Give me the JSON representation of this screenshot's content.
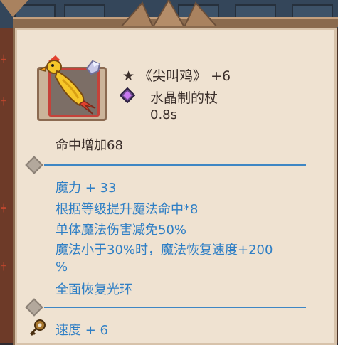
{
  "item": {
    "star": "★",
    "name": "《尖叫鸡》",
    "level": "+6",
    "weapon_type": "水晶制的杖",
    "attack_speed": "0.8s",
    "base_stat": "命中增加68"
  },
  "bonuses": [
    "魔力 + 33",
    "根据等级提升魔法命中*8",
    "单体魔法伤害减免50%",
    "魔法小于30%时，魔法恢复速度+200",
    "%",
    "全面恢复光环"
  ],
  "secondary": {
    "speed": "速度 + 6"
  },
  "colors": {
    "parchment": "#efe2d1",
    "text_dark": "#3a2e2a",
    "text_blue": "#2f7fc5",
    "frame_brown": "#8a6a4e",
    "icon_border_red": "#c5423a"
  },
  "icons": {
    "item_icon": "rubber-chicken-icon",
    "crystal_icon": "crystal-gem-icon",
    "divider_icon": "diamond-icon",
    "key_icon": "key-icon"
  }
}
